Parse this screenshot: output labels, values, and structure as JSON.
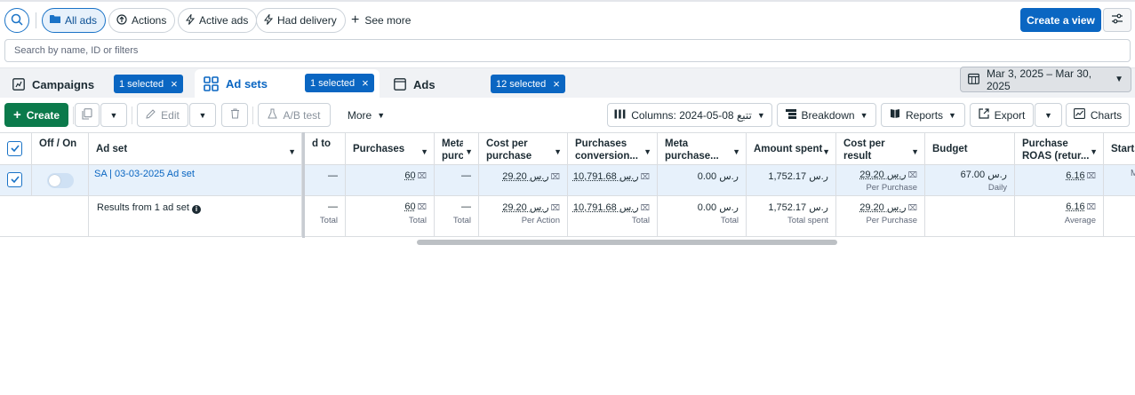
{
  "filters": {
    "all_ads": "All ads",
    "actions": "Actions",
    "active_ads": "Active ads",
    "had_delivery": "Had delivery",
    "see_more": "See more"
  },
  "create_view_label": "Create a view",
  "search": {
    "placeholder": "Search by name, ID or filters"
  },
  "tabs": {
    "campaigns": {
      "label": "Campaigns",
      "badge": "1 selected"
    },
    "adsets": {
      "label": "Ad sets",
      "badge": "1 selected"
    },
    "ads": {
      "label": "Ads",
      "badge": "12 selected"
    }
  },
  "date_range": "Mar 3, 2025 – Mar 30, 2025",
  "toolbar": {
    "create": "Create",
    "edit": "Edit",
    "ab_test": "A/B test",
    "more": "More",
    "columns": "Columns: 2024-05-08 تتبع",
    "breakdown": "Breakdown",
    "reports": "Reports",
    "export": "Export",
    "charts": "Charts"
  },
  "columns": {
    "offon": "Off / On",
    "adset": "Ad set",
    "attributed": "d to",
    "purchases": "Purchases",
    "meta_purc": "Meta purc",
    "cost_per_purchase": "Cost per purchase",
    "purchases_conv": "Purchases conversion...",
    "meta_purchase": "Meta purchase...",
    "amount_spent": "Amount spent",
    "cost_per_result": "Cost per result",
    "budget": "Budget",
    "roas": "Purchase ROAS (retur...",
    "starts": "Starts"
  },
  "row": {
    "name": "SA | 03-03-2025 Ad set",
    "attributed": "—",
    "purchases": "60",
    "meta_purc": "—",
    "cost_per_purchase": "29.20 ر.س",
    "purchases_conv": "10,791.68 ر.س",
    "meta_purchase": "0.00 ر.س",
    "amount_spent": "1,752.17 ر.س",
    "cost_per_result": "29.20 ر.س",
    "cost_per_result_sub": "Per Purchase",
    "budget": "67.00 ر.س",
    "budget_sub": "Daily",
    "roas": "6.16",
    "starts": "M"
  },
  "summary": {
    "label": "Results from 1 ad set",
    "attributed": "—",
    "attributed_sub": "Total",
    "purchases": "60",
    "purchases_sub": "Total",
    "meta_purc": "—",
    "meta_purc_sub": "Total",
    "cost_per_purchase": "29.20 ر.س",
    "cost_per_purchase_sub": "Per Action",
    "purchases_conv": "10,791.68 ر.س",
    "purchases_conv_sub": "Total",
    "meta_purchase": "0.00 ر.س",
    "meta_purchase_sub": "Total",
    "amount_spent": "1,752.17 ر.س",
    "amount_spent_sub": "Total spent",
    "cost_per_result": "29.20 ر.س",
    "cost_per_result_sub": "Per Purchase",
    "roas": "6.16",
    "roas_sub": "Average"
  }
}
